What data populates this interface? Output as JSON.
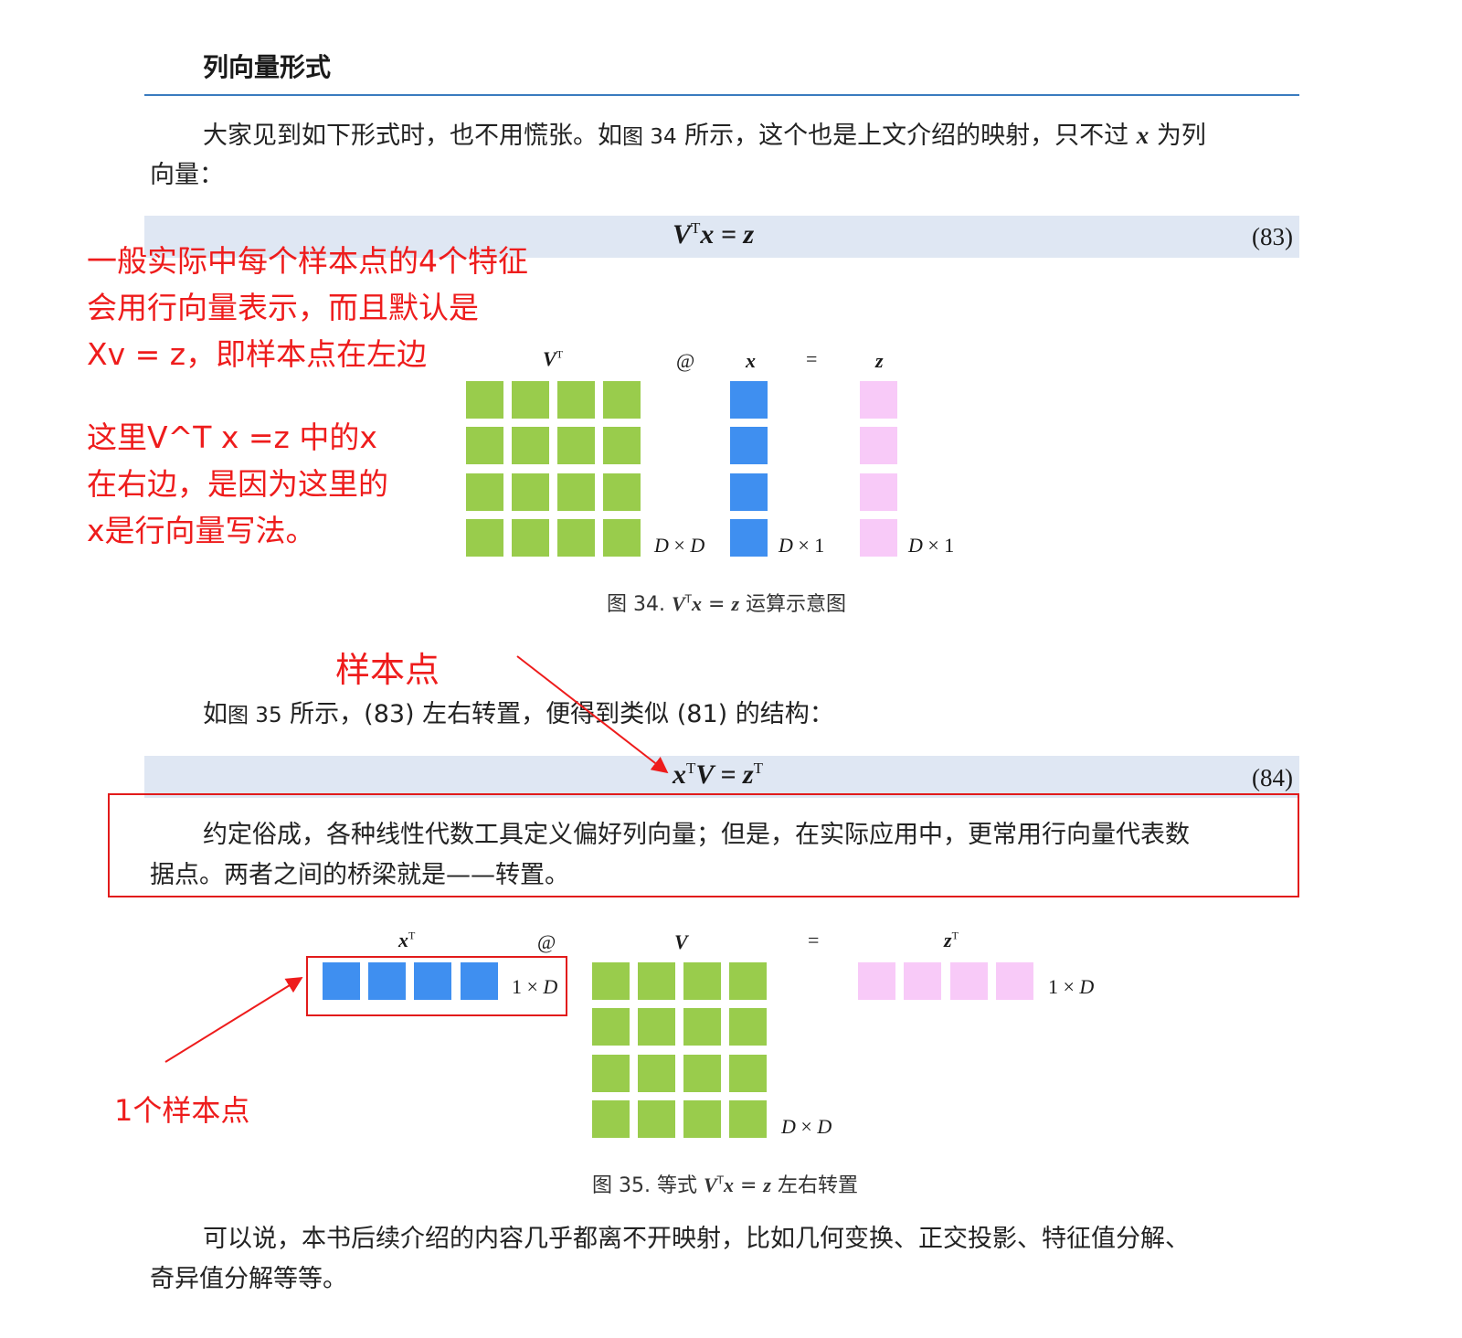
{
  "section_title": "列向量形式",
  "para1": {
    "text_a": "大家见到如下形式时，也不用慌张。如",
    "ref": "图 34",
    "text_b": " 所示，这个也是上文介绍的映射，只不过 ",
    "var": "x",
    "text_c": " 为列",
    "line2": "向量："
  },
  "eq83": {
    "V": "V",
    "T": "T",
    "rest": "x = z",
    "num": "(83)"
  },
  "fig34": {
    "label_vt": "V",
    "label_vt_sup": "T",
    "op_at": "@",
    "label_x": "x",
    "op_eq": "=",
    "label_z": "z",
    "dim_a": "D",
    "dim_times": " × ",
    "dim_b": "D",
    "dim_x_a": "D",
    "dim_x_b": " × 1",
    "dim_z_a": "D",
    "dim_z_b": " × 1",
    "caption_a": "图 34. ",
    "caption_V": "V",
    "caption_T": "T",
    "caption_x": "x",
    "caption_eq": " = ",
    "caption_z": "z",
    "caption_b": " 运算示意图"
  },
  "annotation_left": {
    "line1": "一般实际中每个样本点的4个特征",
    "line2": "会用行向量表示，而且默认是",
    "line3": "Xv = z，即样本点在左边",
    "line4": "这里V^T x =z 中的x",
    "line5": "在右边，是因为这里的",
    "line6": "x是行向量写法。"
  },
  "annotation_sample": "样本点",
  "para2": {
    "text_a": "如",
    "ref": "图 35",
    "text_b": " 所示，(83) 左右转置，便得到类似 (81) 的结构："
  },
  "eq84": {
    "x": "x",
    "T1": "T",
    "V": "V",
    "mid": " = ",
    "z": "z",
    "T2": "T",
    "num": "(84)"
  },
  "para3": {
    "line1": "约定俗成，各种线性代数工具定义偏好列向量；但是，在实际应用中，更常用行向量代表数",
    "line2": "据点。两者之间的桥梁就是——转置。"
  },
  "fig35": {
    "label_xt": "x",
    "label_xt_sup": "T",
    "op_at": "@",
    "label_v": "V",
    "op_eq": "=",
    "label_zt": "z",
    "label_zt_sup": "T",
    "dim_x_a": "1 × ",
    "dim_x_b": "D",
    "dim_v_a": "D",
    "dim_v_times": " × ",
    "dim_v_b": "D",
    "dim_z_a": "1 × ",
    "dim_z_b": "D",
    "caption_a": "图 35. 等式 ",
    "caption_V": "V",
    "caption_T": "T",
    "caption_x": "x",
    "caption_eq": " = ",
    "caption_z": "z",
    "caption_b": " 左右转置"
  },
  "annotation_one_sample": "1个样本点",
  "para4": {
    "line1": "可以说，本书后续介绍的内容几乎都离不开映射，比如几何变换、正交投影、特征值分解、",
    "line2": "奇异值分解等等。"
  },
  "colors": {
    "green": "#99cc4c",
    "blue": "#3f8ff0",
    "pink": "#f8caf8",
    "annotation_red": "#ee1c1c",
    "equation_band": "#dfe7f3",
    "rule_blue": "#3a7bbf"
  }
}
